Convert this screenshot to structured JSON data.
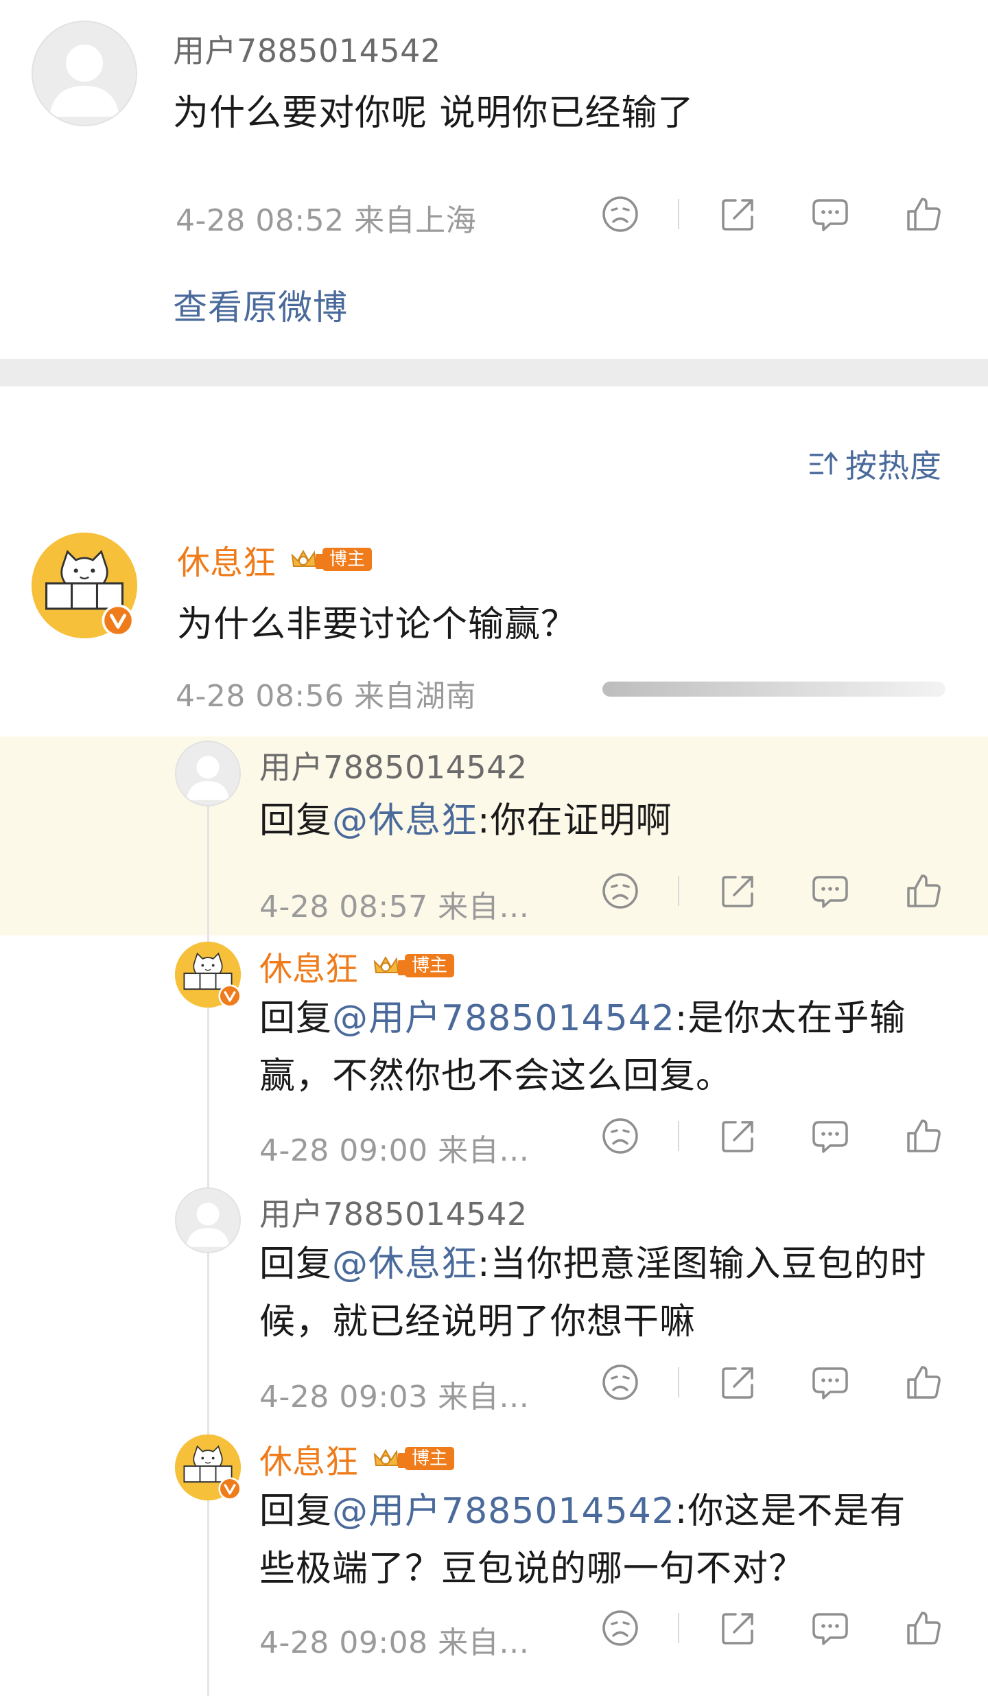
{
  "top_comment": {
    "username": "用户7885014542",
    "text": "为什么要对你呢 说明你已经输了",
    "meta": "4-28 08:52  来自上海",
    "view_original": "查看原微博"
  },
  "sort": {
    "label": "按热度",
    "icon": "sort-icon"
  },
  "main_comment": {
    "username": "休息狂",
    "badge": "博主",
    "text": "为什么非要讨论个输赢？",
    "meta": "4-28 08:56  来自湖南",
    "avatar_label": "休息狂"
  },
  "replies": [
    {
      "username": "用户7885014542",
      "reply_prefix": "回复",
      "mention": "@休息狂",
      "content": ":你在证明啊",
      "meta": "4-28 08:57  来自…",
      "highlighted": true
    },
    {
      "username": "休息狂",
      "badge": "博主",
      "reply_prefix": "回复",
      "mention": "@用户7885014542",
      "content": ":是你太在乎输赢，不然你也不会这么回复。",
      "meta": "4-28 09:00  来自…"
    },
    {
      "username": "用户7885014542",
      "reply_prefix": "回复",
      "mention": "@休息狂",
      "content": ":当你把意淫图输入豆包的时候，就已经说明了你想干嘛",
      "meta": "4-28 09:03  来自…"
    },
    {
      "username": "休息狂",
      "badge": "博主",
      "reply_prefix": "回复",
      "mention": "@用户7885014542",
      "content": ":你这是不是有些极端了？豆包说的哪一句不对？",
      "meta": "4-28 09:08  来自…"
    }
  ],
  "colors": {
    "orange_name": "#ef7b1a",
    "mention_blue": "#4a6a9b",
    "meta_gray": "#9a9a9a",
    "highlight_bg": "#fdf9e9"
  }
}
